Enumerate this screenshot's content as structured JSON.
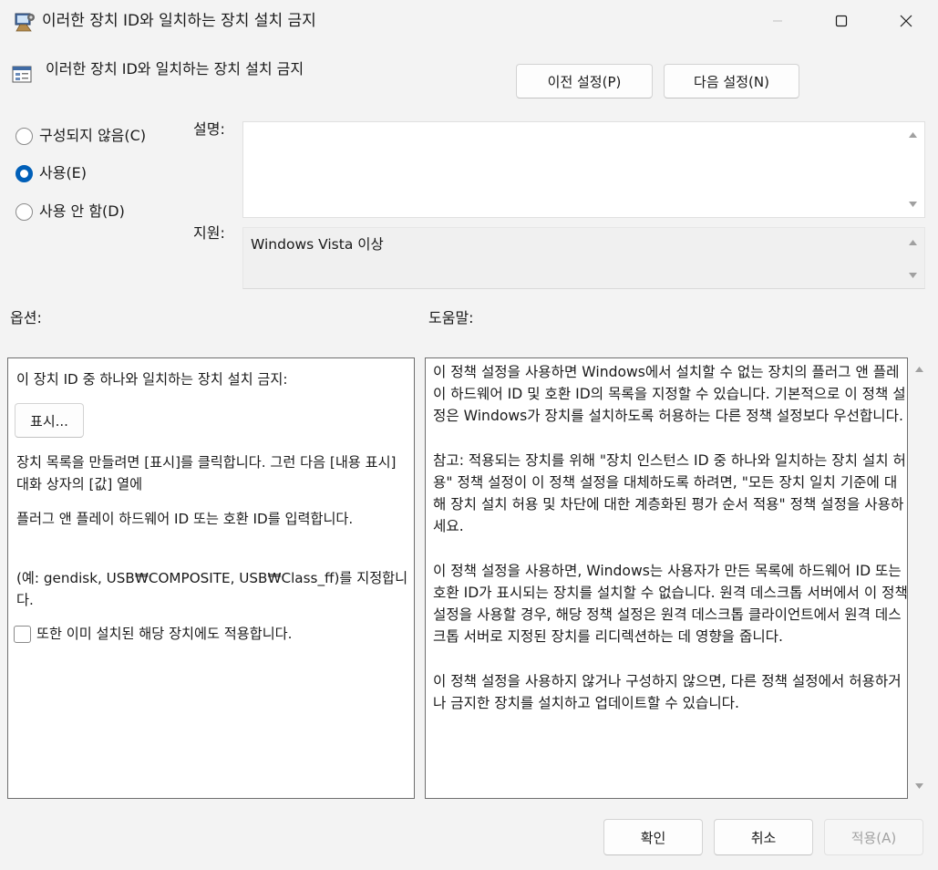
{
  "window": {
    "title": "이러한 장치 ID와 일치하는 장치 설치 금지",
    "controls": {
      "minimize": "minimize",
      "maximize": "maximize",
      "close": "close"
    }
  },
  "header": {
    "policy_name": "이러한 장치 ID와 일치하는 장치 설치 금지",
    "prev_button": "이전 설정(P)",
    "next_button": "다음 설정(N)"
  },
  "state": {
    "options": [
      {
        "label": "구성되지 않음(C)",
        "checked": false
      },
      {
        "label": "사용(E)",
        "checked": true
      },
      {
        "label": "사용 안 함(D)",
        "checked": false
      }
    ]
  },
  "comment": {
    "label": "설명:",
    "value": ""
  },
  "supported": {
    "label": "지원:",
    "value": "Windows Vista 이상"
  },
  "options_section": {
    "heading": "옵션:",
    "intro": "이 장치 ID 중 하나와 일치하는 장치 설치 금지:",
    "show_button": "표시...",
    "para1": "장치 목록을 만들려면 [표시]를 클릭합니다. 그런 다음 [내용 표시] 대화 상자의 [값] 열에",
    "para2": "플러그 앤 플레이 하드웨어 ID 또는 호환 ID를 입력합니다.",
    "para3": "(예: gendisk,  USB₩COMPOSITE,  USB₩Class_ff)를 지정합니다.",
    "checkbox_label": "또한 이미 설치된 해당 장치에도 적용합니다.",
    "checkbox_checked": false
  },
  "help_section": {
    "heading": "도움말:",
    "paragraphs": [
      "이 정책 설정을 사용하면 Windows에서 설치할 수 없는 장치의 플러그 앤 플레이 하드웨어 ID 및 호환 ID의 목록을 지정할 수 있습니다. 기본적으로 이 정책 설정은 Windows가 장치를 설치하도록 허용하는 다른 정책 설정보다 우선합니다.",
      "참고: 적용되는 장치를 위해 \"장치 인스턴스 ID 중 하나와 일치하는 장치 설치 허용\" 정책 설정이 이 정책 설정을 대체하도록 하려면, \"모든 장치 일치 기준에 대해 장치 설치 허용 및 차단에 대한 계층화된 평가 순서 적용\" 정책 설정을 사용하세요.",
      "이 정책 설정을 사용하면, Windows는 사용자가 만든 목록에 하드웨어 ID 또는 호환 ID가 표시되는 장치를 설치할 수 없습니다. 원격 데스크톱 서버에서 이 정책 설정을 사용할 경우, 해당 정책 설정은 원격 데스크톱 클라이언트에서 원격 데스크톱 서버로 지정된 장치를 리디렉션하는 데 영향을 줍니다.",
      "이 정책 설정을 사용하지 않거나 구성하지 않으면, 다른 정책 설정에서 허용하거나 금지한 장치를 설치하고 업데이트할 수 있습니다."
    ]
  },
  "footer": {
    "ok": "확인",
    "cancel": "취소",
    "apply": "적용(A)"
  },
  "colors": {
    "accent": "#005fb8",
    "background": "#f3f3f3",
    "panel_border": "#6e6e6e"
  },
  "icons": [
    "policy-app-icon",
    "policy-setting-icon",
    "minimize-icon",
    "maximize-icon",
    "close-icon",
    "scroll-up-icon",
    "scroll-down-icon"
  ]
}
